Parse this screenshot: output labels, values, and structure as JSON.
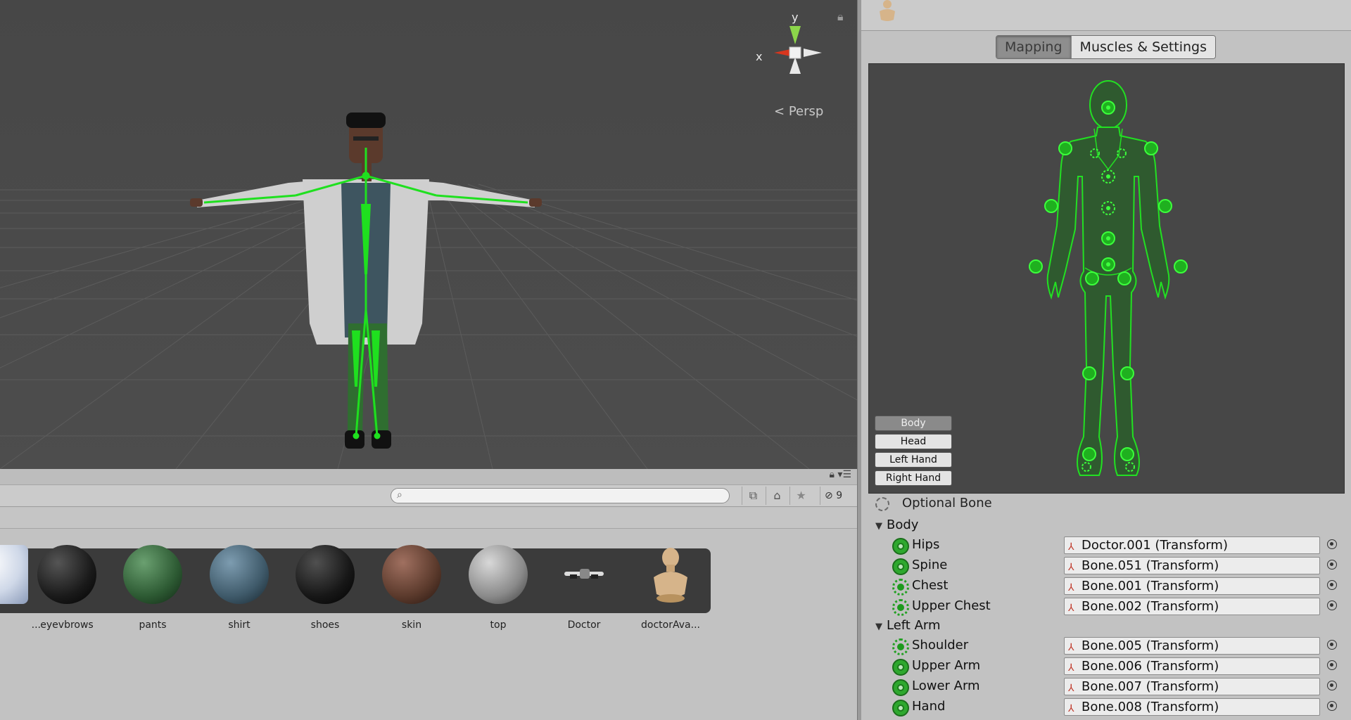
{
  "scene": {
    "gizmo": {
      "y_label": "y",
      "x_label": "x"
    },
    "persp_label": "Persp"
  },
  "project": {
    "search": {
      "value": "",
      "placeholder": ""
    },
    "hidden_count": "9",
    "assets": [
      {
        "label": "...",
        "kind": "material",
        "color": "#cfd8e8"
      },
      {
        "label": "eyevbrows",
        "kind": "material",
        "color": "#1a1a1a"
      },
      {
        "label": "pants",
        "kind": "material",
        "color": "#2d5a33"
      },
      {
        "label": "shirt",
        "kind": "material",
        "color": "#3f5a6a"
      },
      {
        "label": "shoes",
        "kind": "material",
        "color": "#171717"
      },
      {
        "label": "skin",
        "kind": "material",
        "color": "#5b3a2c"
      },
      {
        "label": "top",
        "kind": "material",
        "color": "#8a8a8a"
      },
      {
        "label": "Doctor",
        "kind": "model-icon"
      },
      {
        "label": "doctorAva...",
        "kind": "avatar-icon"
      }
    ]
  },
  "inspector": {
    "tabs": [
      {
        "label": "Mapping",
        "active": true
      },
      {
        "label": "Muscles & Settings",
        "active": false
      }
    ],
    "part_buttons": [
      {
        "label": "Body",
        "active": true
      },
      {
        "label": "Head",
        "active": false
      },
      {
        "label": "Left Hand",
        "active": false
      },
      {
        "label": "Right Hand",
        "active": false
      }
    ],
    "optional_bone_label": "Optional Bone",
    "groups": [
      {
        "name": "Body",
        "bones": [
          {
            "label": "Hips",
            "value": "Doctor.001 (Transform)",
            "optional": false
          },
          {
            "label": "Spine",
            "value": "Bone.051 (Transform)",
            "optional": false
          },
          {
            "label": "Chest",
            "value": "Bone.001 (Transform)",
            "optional": true
          },
          {
            "label": "Upper Chest",
            "value": "Bone.002 (Transform)",
            "optional": true
          }
        ]
      },
      {
        "name": "Left Arm",
        "bones": [
          {
            "label": "Shoulder",
            "value": "Bone.005 (Transform)",
            "optional": true
          },
          {
            "label": "Upper Arm",
            "value": "Bone.006 (Transform)",
            "optional": false
          },
          {
            "label": "Lower Arm",
            "value": "Bone.007 (Transform)",
            "optional": false
          },
          {
            "label": "Hand",
            "value": "Bone.008 (Transform)",
            "optional": false
          }
        ]
      }
    ]
  },
  "colors": {
    "bone_green": "#1fe01f",
    "scene_bg": "#474747",
    "panel_bg": "#c2c2c2"
  }
}
